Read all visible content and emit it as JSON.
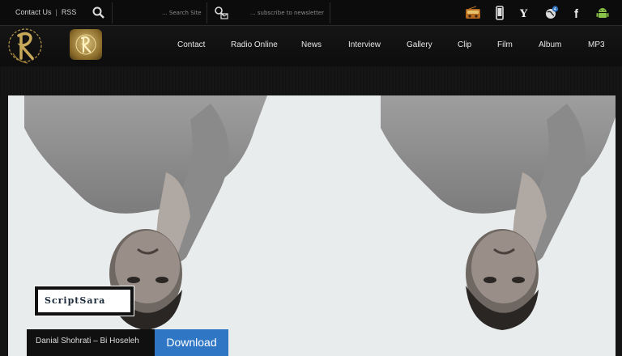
{
  "topbar": {
    "contact_link": "Contact Us",
    "rss_link": "RSS",
    "search_placeholder": "... Search Site",
    "newsletter_placeholder": "... subscribe to newsletter",
    "notification_count": "4"
  },
  "nav": {
    "items": [
      "Contact",
      "Radio Online",
      "News",
      "Interview",
      "Gallery",
      "Clip",
      "Film",
      "Album",
      "MP3"
    ]
  },
  "hero": {
    "brand_text": "ScriptSara",
    "caption": "Danial Shohrati – Bi Hoseleh",
    "download_label": "Download"
  },
  "icons": [
    "search-icon",
    "newsletter-icon",
    "radio-icon",
    "mobile-icon",
    "yahoo-icon",
    "globe-icon",
    "facebook-icon",
    "android-icon"
  ],
  "colors": {
    "accent": "#2f77c5",
    "logo_gold": "#c9a95a",
    "bg": "#141414"
  }
}
